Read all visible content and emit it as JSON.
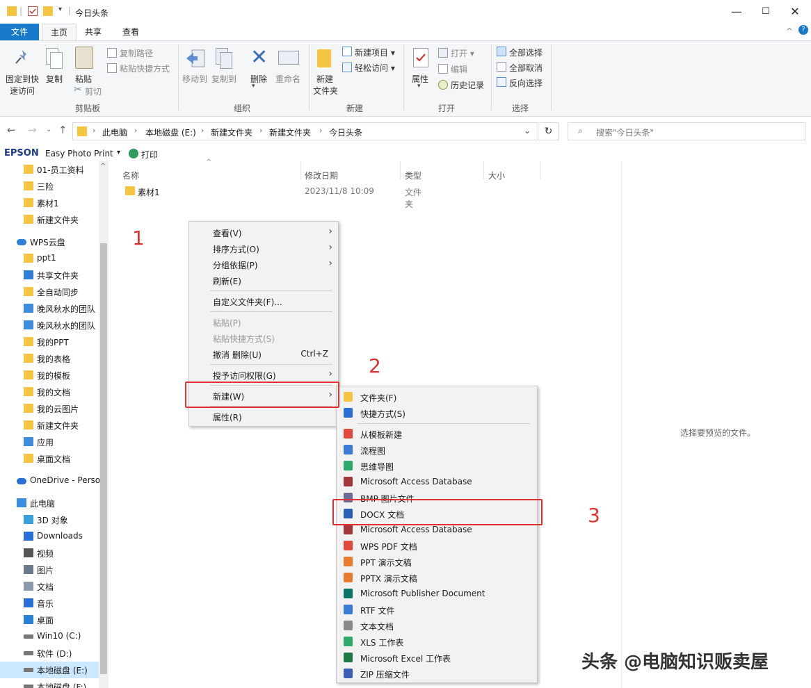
{
  "window": {
    "title": "今日头条",
    "minimize": "—",
    "maximize": "☐",
    "close": "✕",
    "help": "?",
    "collapse": "^"
  },
  "tabs": [
    "文件",
    "主页",
    "共享",
    "查看"
  ],
  "ribbon": {
    "clipboard": {
      "pin": "固定到快\n速访问",
      "pin_line1": "固定到快",
      "pin_line2": "速访问",
      "copy": "复制",
      "paste": "粘贴",
      "copy_path": "复制路径",
      "paste_shortcut": "粘贴快捷方式",
      "cut": "剪切",
      "group": "剪贴板"
    },
    "organize": {
      "move_to": "移动到",
      "copy_to": "复制到",
      "delete": "删除",
      "rename": "重命名",
      "group": "组织"
    },
    "new": {
      "new_folder_line1": "新建",
      "new_folder_line2": "文件夹",
      "new_item": "新建项目",
      "easy_access": "轻松访问",
      "group": "新建"
    },
    "open": {
      "properties": "属性",
      "open": "打开",
      "edit": "编辑",
      "history": "历史记录",
      "group": "打开"
    },
    "select": {
      "select_all": "全部选择",
      "select_none": "全部取消",
      "invert": "反向选择",
      "group": "选择"
    }
  },
  "address": {
    "crumbs": [
      "此电脑",
      "本地磁盘 (E:)",
      "新建文件夹",
      "新建文件夹",
      "今日头条"
    ],
    "search_placeholder": "搜索\"今日头条\""
  },
  "epson": {
    "brand": "EPSON",
    "app": "Easy Photo Print",
    "print": "打印"
  },
  "nav": [
    {
      "label": "01-员工资料",
      "icon": "folder-icon",
      "indent": 2
    },
    {
      "label": "三险",
      "icon": "folder-icon",
      "indent": 2
    },
    {
      "label": "素材1",
      "icon": "folder-icon",
      "indent": 2
    },
    {
      "label": "新建文件夹",
      "icon": "folder-icon",
      "indent": 2
    },
    {
      "label": "WPS云盘",
      "icon": "cloud-icon",
      "indent": 1
    },
    {
      "label": "ppt1",
      "icon": "folder-icon",
      "indent": 2
    },
    {
      "label": "共享文件夹",
      "icon": "share-icon",
      "indent": 2
    },
    {
      "label": "全自动同步",
      "icon": "folder-icon",
      "indent": 2
    },
    {
      "label": "晚风秋水的团队",
      "icon": "team-icon",
      "indent": 2
    },
    {
      "label": "晚风秋水的团队",
      "icon": "team-icon",
      "indent": 2
    },
    {
      "label": "我的PPT",
      "icon": "folder-icon",
      "indent": 2
    },
    {
      "label": "我的表格",
      "icon": "folder-icon",
      "indent": 2
    },
    {
      "label": "我的模板",
      "icon": "folder-icon",
      "indent": 2
    },
    {
      "label": "我的文档",
      "icon": "folder-icon",
      "indent": 2
    },
    {
      "label": "我的云图片",
      "icon": "folder-icon",
      "indent": 2
    },
    {
      "label": "新建文件夹",
      "icon": "folder-icon",
      "indent": 2
    },
    {
      "label": "应用",
      "icon": "apps-icon",
      "indent": 2
    },
    {
      "label": "桌面文档",
      "icon": "folder-icon",
      "indent": 2
    },
    {
      "label": "OneDrive - Perso",
      "icon": "onedrive-icon",
      "indent": 1
    },
    {
      "label": "此电脑",
      "icon": "pc-icon",
      "indent": 1
    },
    {
      "label": "3D 对象",
      "icon": "cube-icon",
      "indent": 2
    },
    {
      "label": "Downloads",
      "icon": "download-icon",
      "indent": 2
    },
    {
      "label": "视频",
      "icon": "video-icon",
      "indent": 2
    },
    {
      "label": "图片",
      "icon": "picture-icon",
      "indent": 2
    },
    {
      "label": "文档",
      "icon": "document-icon",
      "indent": 2
    },
    {
      "label": "音乐",
      "icon": "music-icon",
      "indent": 2
    },
    {
      "label": "桌面",
      "icon": "desktop-icon",
      "indent": 2
    },
    {
      "label": "Win10 (C:)",
      "icon": "drive-icon",
      "indent": 2
    },
    {
      "label": "软件 (D:)",
      "icon": "drive-icon",
      "indent": 2
    },
    {
      "label": "本地磁盘 (E:)",
      "icon": "drive-icon",
      "indent": 2,
      "selected": true
    },
    {
      "label": "本地磁盘 (F:)",
      "icon": "drive-icon",
      "indent": 2
    }
  ],
  "list": {
    "columns": [
      "名称",
      "修改日期",
      "类型",
      "大小"
    ],
    "rows": [
      {
        "name": "素材1",
        "date": "2023/11/8 10:09",
        "type": "文件夹",
        "size": ""
      }
    ],
    "preview_text": "选择要预览的文件。"
  },
  "context_menu": [
    {
      "label": "查看(V)",
      "arrow": true
    },
    {
      "label": "排序方式(O)",
      "arrow": true
    },
    {
      "label": "分组依据(P)",
      "arrow": true
    },
    {
      "label": "刷新(E)"
    },
    {
      "sep": true
    },
    {
      "label": "自定义文件夹(F)..."
    },
    {
      "sep": true
    },
    {
      "label": "粘贴(P)",
      "disabled": true
    },
    {
      "label": "粘贴快捷方式(S)",
      "disabled": true
    },
    {
      "label": "撤消 删除(U)",
      "shortcut": "Ctrl+Z"
    },
    {
      "sep": true
    },
    {
      "label": "授予访问权限(G)",
      "arrow": true
    },
    {
      "sep": true
    },
    {
      "label": "新建(W)",
      "arrow": true,
      "highlight": true
    },
    {
      "sep": true
    },
    {
      "label": "属性(R)"
    }
  ],
  "submenu": [
    {
      "label": "文件夹(F)",
      "icon": "folder-icon",
      "color": "#f5c542"
    },
    {
      "label": "快捷方式(S)",
      "icon": "shortcut-icon",
      "color": "#2a6fd6"
    },
    {
      "sep": true
    },
    {
      "label": "从模板新建",
      "icon": "template-icon",
      "color": "#e0483c"
    },
    {
      "label": "流程图",
      "icon": "flowchart-icon",
      "color": "#3a7bd5"
    },
    {
      "label": "思维导图",
      "icon": "mindmap-icon",
      "color": "#2fa96b"
    },
    {
      "label": "Microsoft Access Database",
      "icon": "access-icon",
      "color": "#a4373a"
    },
    {
      "label": "BMP 图片文件",
      "icon": "bmp-icon",
      "color": "#6d6d9a"
    },
    {
      "label": "DOCX 文档",
      "icon": "docx-icon",
      "color": "#2b5fb4"
    },
    {
      "label": "Microsoft Access Database",
      "icon": "access-icon",
      "color": "#a4373a"
    },
    {
      "label": "WPS PDF 文档",
      "icon": "pdf-icon",
      "color": "#e0483c"
    },
    {
      "label": "PPT 演示文稿",
      "icon": "ppt-icon",
      "color": "#e87b2c"
    },
    {
      "label": "PPTX 演示文稿",
      "icon": "pptx-icon",
      "color": "#e87b2c"
    },
    {
      "label": "Microsoft Publisher Document",
      "icon": "publisher-icon",
      "color": "#077568"
    },
    {
      "label": "RTF 文件",
      "icon": "rtf-icon",
      "color": "#3a7bd5"
    },
    {
      "label": "文本文档",
      "icon": "text-icon",
      "color": "#8a8a8a"
    },
    {
      "label": "XLS 工作表",
      "icon": "xls-icon",
      "color": "#2fa96b"
    },
    {
      "label": "Microsoft Excel 工作表",
      "icon": "excel-icon",
      "color": "#1e7a45"
    },
    {
      "label": "ZIP 压缩文件",
      "icon": "zip-icon",
      "color": "#3a5fb4"
    }
  ],
  "annotations": {
    "step1": "1",
    "step2": "2",
    "step3": "3"
  },
  "watermark": "头条 @电脑知识贩卖屋",
  "colors": {
    "accent": "#1979ca",
    "highlight_box": "#e03030",
    "folder": "#f5c542"
  }
}
